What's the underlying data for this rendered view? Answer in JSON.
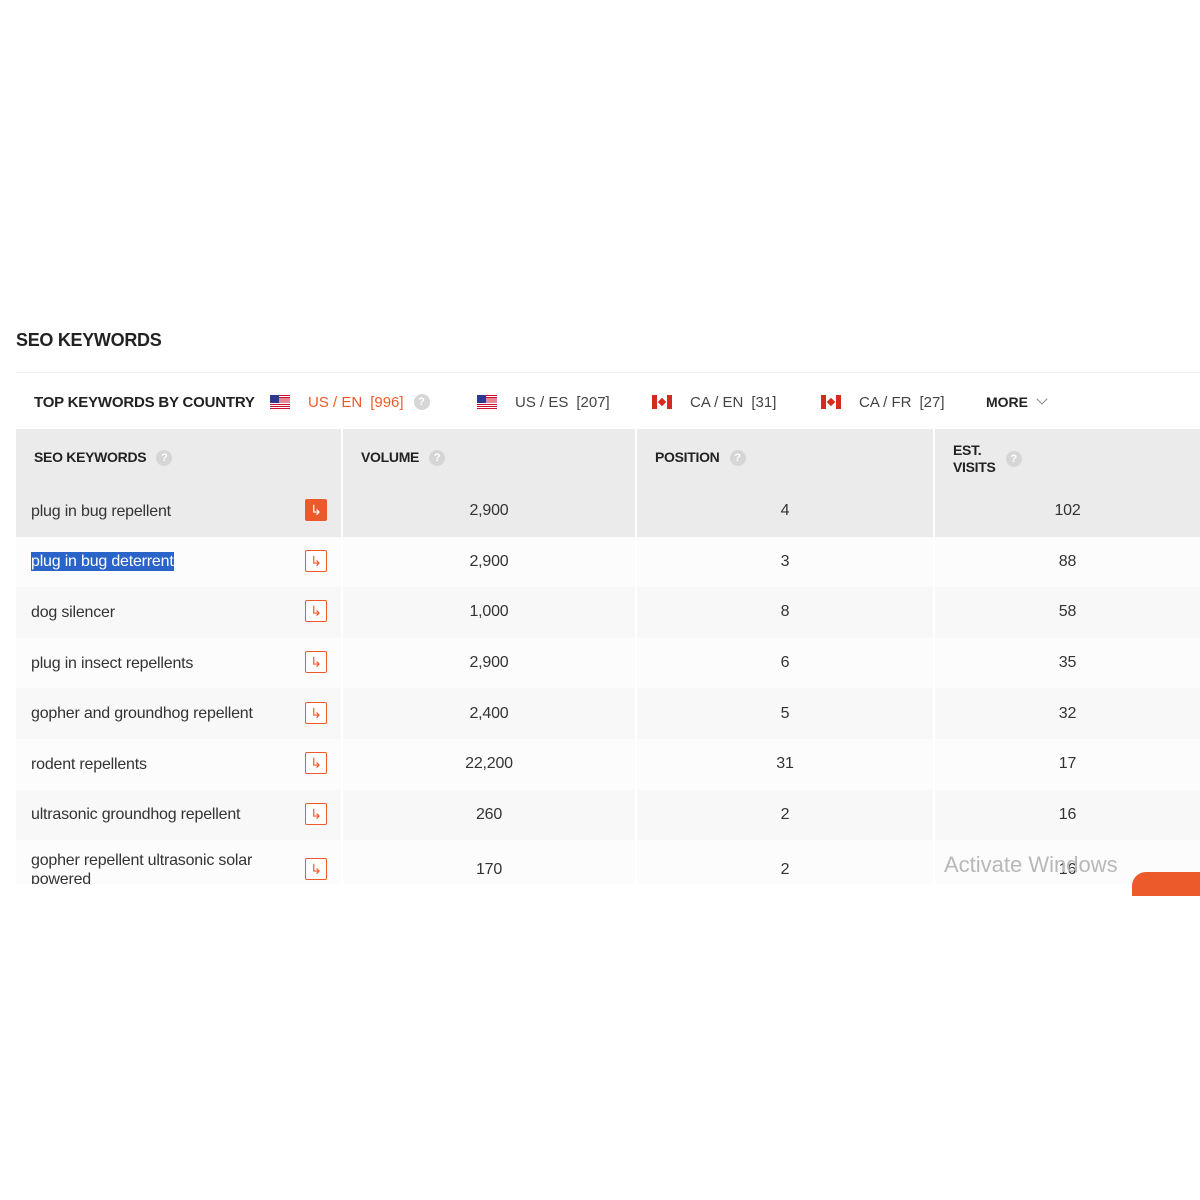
{
  "section_title": "SEO KEYWORDS",
  "country_bar": {
    "label": "TOP KEYWORDS BY COUNTRY",
    "tabs": [
      {
        "flag": "us-flag",
        "label": "US / EN",
        "count": "[996]",
        "active": true,
        "help": "?"
      },
      {
        "flag": "us-flag",
        "label": "US / ES",
        "count": "[207]",
        "active": false
      },
      {
        "flag": "ca-flag",
        "label": "CA / EN",
        "count": "[31]",
        "active": false
      },
      {
        "flag": "ca-flag",
        "label": "CA / FR",
        "count": "[27]",
        "active": false
      }
    ],
    "more_label": "MORE"
  },
  "table": {
    "headers": {
      "keywords": "SEO KEYWORDS",
      "volume": "VOLUME",
      "position": "POSITION",
      "est_visits_line1": "EST.",
      "est_visits_line2": "VISITS",
      "help": "?"
    },
    "rows": [
      {
        "keyword": "plug in bug repellent",
        "volume": "2,900",
        "position": "4",
        "visits": "102"
      },
      {
        "keyword": "plug in bug deterrent",
        "volume": "2,900",
        "position": "3",
        "visits": "88"
      },
      {
        "keyword": "dog silencer",
        "volume": "1,000",
        "position": "8",
        "visits": "58"
      },
      {
        "keyword": "plug in insect repellents",
        "volume": "2,900",
        "position": "6",
        "visits": "35"
      },
      {
        "keyword": "gopher and groundhog repellent",
        "volume": "2,400",
        "position": "5",
        "visits": "32"
      },
      {
        "keyword": "rodent repellents",
        "volume": "22,200",
        "position": "31",
        "visits": "17"
      },
      {
        "keyword": "ultrasonic groundhog repellent",
        "volume": "260",
        "position": "2",
        "visits": "16"
      },
      {
        "keyword": "gopher repellent ultrasonic solar powered",
        "volume": "170",
        "position": "2",
        "visits": "16"
      }
    ],
    "go_icon": "↳"
  },
  "watermark": "Activate Windows",
  "colors": {
    "accent": "#ec5a2c",
    "header_bg": "#ebebeb",
    "selection": "#2a64c8"
  }
}
